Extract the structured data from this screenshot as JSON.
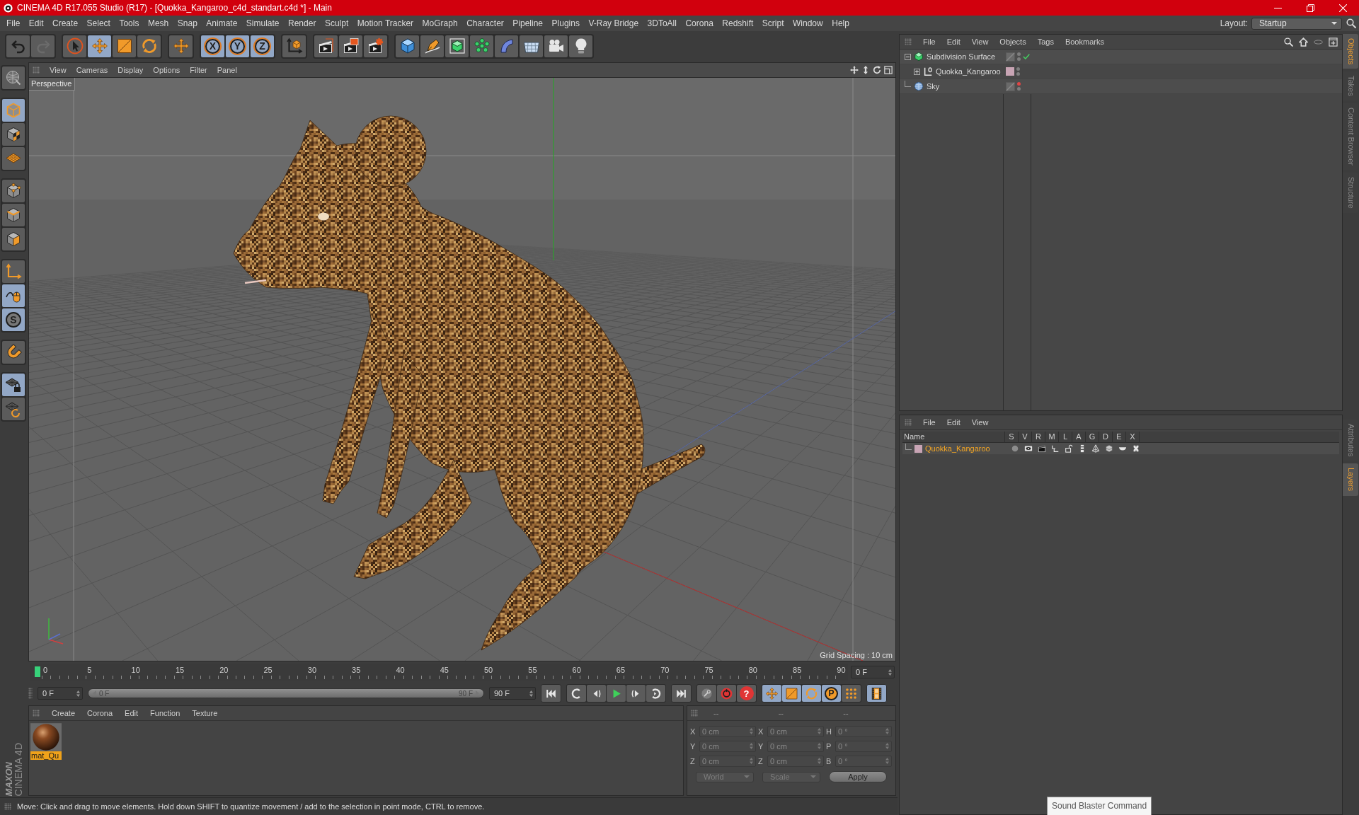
{
  "window": {
    "title": "CINEMA 4D R17.055 Studio (R17) - [Quokka_Kangaroo_c4d_standart.c4d *] - Main"
  },
  "menu_bar": [
    "File",
    "Edit",
    "Create",
    "Select",
    "Tools",
    "Mesh",
    "Snap",
    "Animate",
    "Simulate",
    "Render",
    "Sculpt",
    "Motion Tracker",
    "MoGraph",
    "Character",
    "Pipeline",
    "Plugins",
    "V-Ray Bridge",
    "3DToAll",
    "Corona",
    "Redshift",
    "Script",
    "Window",
    "Help"
  ],
  "layout": {
    "label": "Layout:",
    "value": "Startup"
  },
  "toolbar_groups": [
    [
      {
        "kind": "undo",
        "active": false,
        "disabled": false
      },
      {
        "kind": "redo",
        "active": false,
        "disabled": true
      }
    ],
    [
      {
        "kind": "select",
        "active": false,
        "disabled": false
      },
      {
        "kind": "move",
        "active": true,
        "disabled": false
      },
      {
        "kind": "scale",
        "active": false,
        "disabled": false
      },
      {
        "kind": "rotate",
        "active": false,
        "disabled": false
      }
    ],
    [
      {
        "kind": "move",
        "active": false,
        "disabled": false
      }
    ],
    [
      {
        "kind": "axis",
        "label": "X",
        "active": true,
        "disabled": false
      },
      {
        "kind": "axis",
        "label": "Y",
        "active": true,
        "disabled": false
      },
      {
        "kind": "axis",
        "label": "Z",
        "active": true,
        "disabled": false
      }
    ],
    [
      {
        "kind": "coordinates",
        "active": false,
        "disabled": false
      }
    ],
    [
      {
        "kind": "render-view",
        "active": false,
        "disabled": false
      },
      {
        "kind": "render-picture",
        "active": false,
        "disabled": false
      },
      {
        "kind": "render-settings",
        "active": false,
        "disabled": false
      }
    ],
    [
      {
        "kind": "cube",
        "active": false,
        "disabled": false
      },
      {
        "kind": "pen",
        "active": false,
        "disabled": false
      },
      {
        "kind": "subdivision",
        "active": false,
        "disabled": false
      },
      {
        "kind": "cloner",
        "active": false,
        "disabled": false
      },
      {
        "kind": "deformer",
        "active": false,
        "disabled": false
      },
      {
        "kind": "floor",
        "active": false,
        "disabled": false
      },
      {
        "kind": "camera",
        "active": false,
        "disabled": false
      },
      {
        "kind": "light",
        "active": false,
        "disabled": false
      }
    ]
  ],
  "tool_palette": [
    [
      {
        "kind": "make-editable",
        "active": false
      }
    ],
    [
      {
        "kind": "model-mode",
        "active": true
      },
      {
        "kind": "texture-mode",
        "active": false
      },
      {
        "kind": "workplane-mode",
        "active": false
      }
    ],
    [
      {
        "kind": "points-mode",
        "active": false
      },
      {
        "kind": "edges-mode",
        "active": false
      },
      {
        "kind": "polygons-mode",
        "active": false
      }
    ],
    [
      {
        "kind": "axis-mode",
        "active": false
      },
      {
        "kind": "tweak-mode",
        "active": true
      },
      {
        "kind": "solo",
        "label": "S",
        "active": true
      }
    ],
    [
      {
        "kind": "snap",
        "active": false
      }
    ],
    [
      {
        "kind": "lock-workplane",
        "active": true
      },
      {
        "kind": "align-workplane",
        "active": false
      }
    ]
  ],
  "logo": [
    "MAXON",
    "CINEMA 4D"
  ],
  "viewport": {
    "menu": [
      "View",
      "Cameras",
      "Display",
      "Options",
      "Filter",
      "Panel"
    ],
    "camera": "Perspective",
    "grid_spacing": "Grid Spacing : 10 cm"
  },
  "timeline": {
    "ticks": [
      "0",
      "5",
      "10",
      "15",
      "20",
      "25",
      "30",
      "35",
      "40",
      "45",
      "50",
      "55",
      "60",
      "65",
      "70",
      "75",
      "80",
      "85",
      "90"
    ],
    "playhead": {
      "level": 0
    },
    "frame": "0 F"
  },
  "transport": {
    "start": "0 F",
    "range_start": "0 F",
    "range_end": "90 F",
    "end": "90 F",
    "playback_groups": [
      [
        {
          "kind": "first"
        }
      ],
      [
        {
          "kind": "prev-key"
        },
        {
          "kind": "prev-frame"
        },
        {
          "kind": "play"
        },
        {
          "kind": "next-frame"
        },
        {
          "kind": "next-key"
        }
      ],
      [
        {
          "kind": "last"
        }
      ]
    ],
    "record": [
      {
        "kind": "keyframe"
      },
      {
        "kind": "record"
      },
      {
        "kind": "autokey",
        "label": "?"
      }
    ],
    "tracks": [
      {
        "kind": "position",
        "active": true
      },
      {
        "kind": "scale",
        "active": true
      },
      {
        "kind": "rotation",
        "active": true
      },
      {
        "kind": "parameter",
        "label": "P",
        "active": true
      },
      {
        "kind": "points",
        "active": false
      }
    ],
    "timeline_view": {
      "active": true
    }
  },
  "materials": {
    "menu": [
      "Create",
      "Corona",
      "Edit",
      "Function",
      "Texture"
    ],
    "items": [
      {
        "name": "mat_Qu",
        "selected": true
      }
    ]
  },
  "coordinates": {
    "headers": [
      "--",
      "--",
      "--"
    ],
    "disabled": true,
    "rows": [
      {
        "position_axis": "X",
        "position": "0 cm",
        "size_axis": "X",
        "size": "0 cm",
        "rotation_axis": "H",
        "rotation": "0 °"
      },
      {
        "position_axis": "Y",
        "position": "0 cm",
        "size_axis": "Y",
        "size": "0 cm",
        "rotation_axis": "P",
        "rotation": "0 °"
      },
      {
        "position_axis": "Z",
        "position": "0 cm",
        "size_axis": "Z",
        "size": "0 cm",
        "rotation_axis": "B",
        "rotation": "0 °"
      }
    ],
    "space": "World",
    "size_mode": "Scale",
    "apply": "Apply"
  },
  "status_bar": "Move: Click and drag to move elements. Hold down SHIFT to quantize movement / add to the selection in point mode, CTRL to remove.",
  "object_manager": {
    "menu": [
      "File",
      "Edit",
      "View",
      "Objects",
      "Tags",
      "Bookmarks"
    ],
    "objects": [
      {
        "name": "Subdivision Surface",
        "kind": "subdivision",
        "expanded": true,
        "editor_hidden": false,
        "render_hidden": false,
        "enabled": true,
        "children": [
          {
            "name": "Quokka_Kangaroo",
            "kind": "null",
            "expanded": false,
            "color": "#c8a4b4",
            "editor_hidden": false,
            "render_hidden": false
          }
        ]
      },
      {
        "name": "Sky",
        "kind": "sky",
        "editor_hidden": true,
        "render_hidden": false
      }
    ]
  },
  "side_tabs_top": [
    {
      "label": "Objects",
      "selected": true
    },
    {
      "label": "Takes",
      "selected": false
    },
    {
      "label": "Content Browser",
      "selected": false
    },
    {
      "label": "Structure",
      "selected": false
    }
  ],
  "layer_manager": {
    "menu": [
      "File",
      "Edit",
      "View"
    ],
    "columns": [
      "Name",
      "S",
      "V",
      "R",
      "M",
      "L",
      "A",
      "G",
      "D",
      "E",
      "X"
    ],
    "layers": [
      {
        "name": "Quokka_Kangaroo",
        "color": "#c8a4b4",
        "selected": true,
        "flags": [
          {
            "kind": "solo",
            "on": false
          },
          {
            "kind": "view",
            "on": true
          },
          {
            "kind": "render",
            "on": true
          },
          {
            "kind": "manager",
            "on": true
          },
          {
            "kind": "lock",
            "on": false
          },
          {
            "kind": "animation",
            "on": true
          },
          {
            "kind": "generators",
            "on": true
          },
          {
            "kind": "deformers",
            "on": true
          },
          {
            "kind": "expressions",
            "on": true
          },
          {
            "kind": "xrefs",
            "on": true
          }
        ]
      }
    ]
  },
  "side_tabs_bottom": [
    {
      "label": "Attributes",
      "selected": false
    },
    {
      "label": "Layers",
      "selected": true
    }
  ],
  "tooltip": {
    "text": "Sound Blaster Command"
  }
}
